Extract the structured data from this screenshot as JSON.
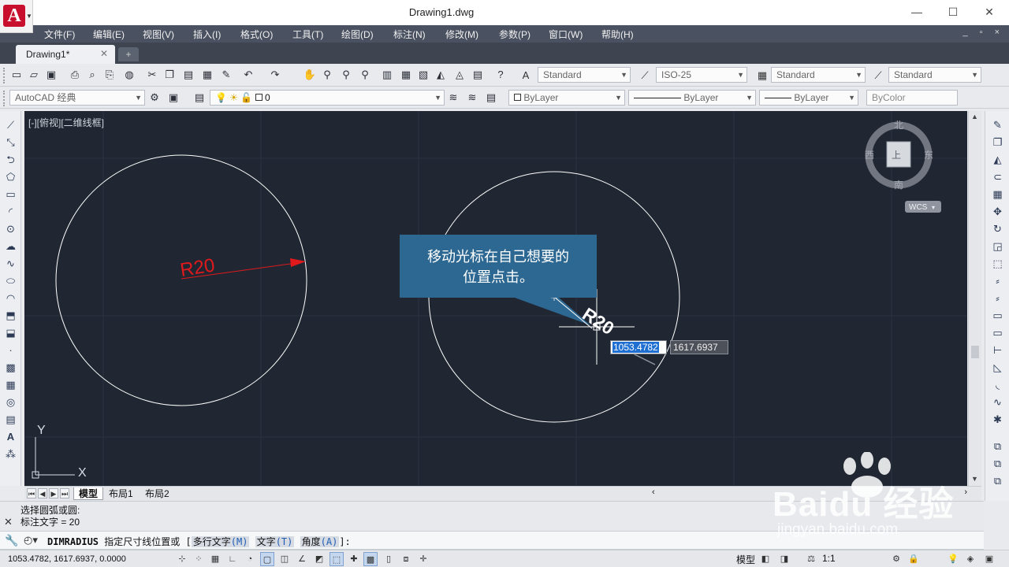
{
  "window": {
    "title": "Drawing1.dwg",
    "minimize": "—",
    "maximize": "☐",
    "close": "✕"
  },
  "menu": [
    "文件(F)",
    "编辑(E)",
    "视图(V)",
    "插入(I)",
    "格式(O)",
    "工具(T)",
    "绘图(D)",
    "标注(N)",
    "修改(M)",
    "参数(P)",
    "窗口(W)",
    "帮助(H)"
  ],
  "menu_right": "_ ▫ ×",
  "tabs": {
    "active": "Drawing1*",
    "close": "✕",
    "new": "+"
  },
  "toolbar1": {
    "text_style": "Standard",
    "dim_style": "ISO-25",
    "table_style": "Standard",
    "mleader_style": "Standard"
  },
  "toolbar2": {
    "workspace": "AutoCAD 经典",
    "layer": "0",
    "color": "ByLayer",
    "linetype": "ByLayer",
    "lineweight": "ByLayer",
    "plotstyle": "ByColor"
  },
  "viewport": {
    "label": "[-][俯视][二维线框]",
    "dim_left": "R20",
    "dim_right": "R20",
    "crosshair_value": "20",
    "viewcube": {
      "north": "北",
      "south": "南",
      "east": "东",
      "west": "西",
      "ucs": "WCS",
      "face": "上"
    },
    "ucs_x": "X",
    "ucs_y": "Y"
  },
  "callout": {
    "line1": "移动光标在自己想要的",
    "line2": "位置点击。"
  },
  "dynamic_input": {
    "x": "1053.4782",
    "y": "1617.6937"
  },
  "layout_tabs": [
    "模型",
    "布局1",
    "布局2"
  ],
  "command": {
    "history": [
      "选择圆弧或圆:",
      "标注文字 = 20"
    ],
    "name": "DIMRADIUS",
    "prompt": "指定尺寸线位置或",
    "options": [
      {
        "label": "多行文字",
        "key": "(M)"
      },
      {
        "label": "文字",
        "key": "(T)"
      },
      {
        "label": "角度",
        "key": "(A)"
      }
    ],
    "suffix": "]:"
  },
  "status": {
    "coords": "1053.4782,  1617.6937,  0.0000",
    "model": "模型",
    "scale": "1:1"
  },
  "watermark": {
    "brand": "Baidu 经验",
    "url": "jingyan.baidu.com"
  },
  "colors": {
    "viewport_bg": "#212732",
    "menu_bg": "#4a5160",
    "accent_blue": "#1e6fd1",
    "dim_red": "#e0191c",
    "callout_bg": "#2d6892"
  }
}
